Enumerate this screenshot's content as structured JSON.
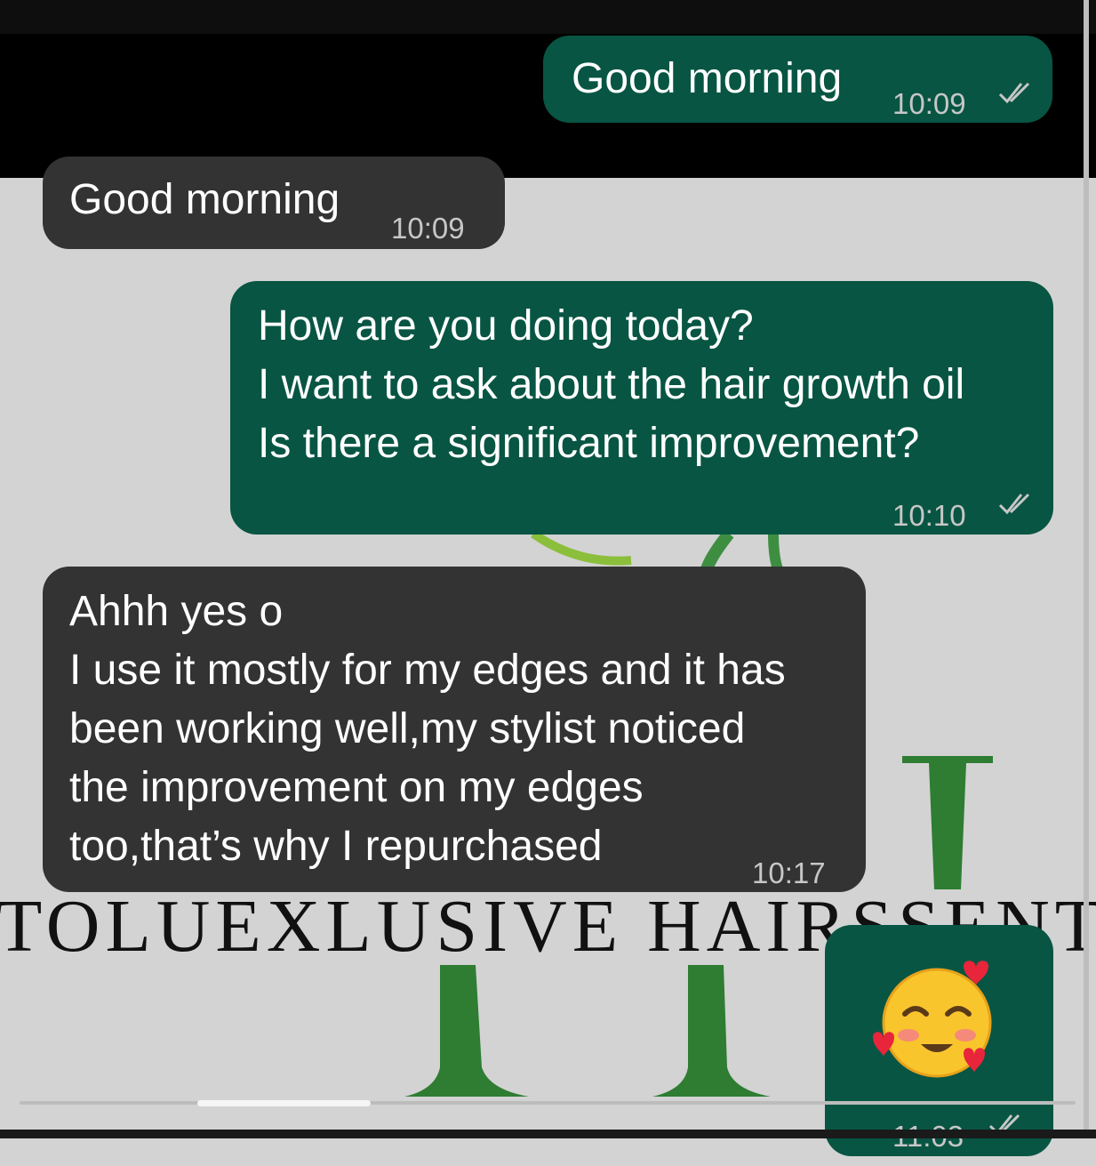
{
  "chat": {
    "messages": [
      {
        "direction": "out",
        "text_lines": [
          "Good morning"
        ],
        "time": "10:09",
        "status": "read"
      },
      {
        "direction": "in",
        "text_lines": [
          "Good morning"
        ],
        "time": "10:09"
      },
      {
        "direction": "out",
        "text_lines": [
          "How are you doing today?",
          "I want to ask about the hair growth oil",
          "Is there a significant improvement?"
        ],
        "time": "10:10",
        "status": "read"
      },
      {
        "direction": "in",
        "text_lines": [
          "Ahhh yes o",
          "I use it mostly for my edges and it has",
          "been working well,my stylist noticed",
          "the improvement on my edges",
          "too,that’s why I repurchased"
        ],
        "time": "10:17"
      },
      {
        "direction": "out",
        "emoji_icon": "smiling-face-with-hearts-icon",
        "time": "11:03",
        "status": "read"
      }
    ]
  },
  "watermark": {
    "brand_text": "TOLUEXLUSIVE HAIRSSENT"
  },
  "colors": {
    "outgoing_bubble": "#085543",
    "incoming_bubble": "#333333",
    "background": "#d3d3d3",
    "logo_green": "#2e7d32"
  }
}
